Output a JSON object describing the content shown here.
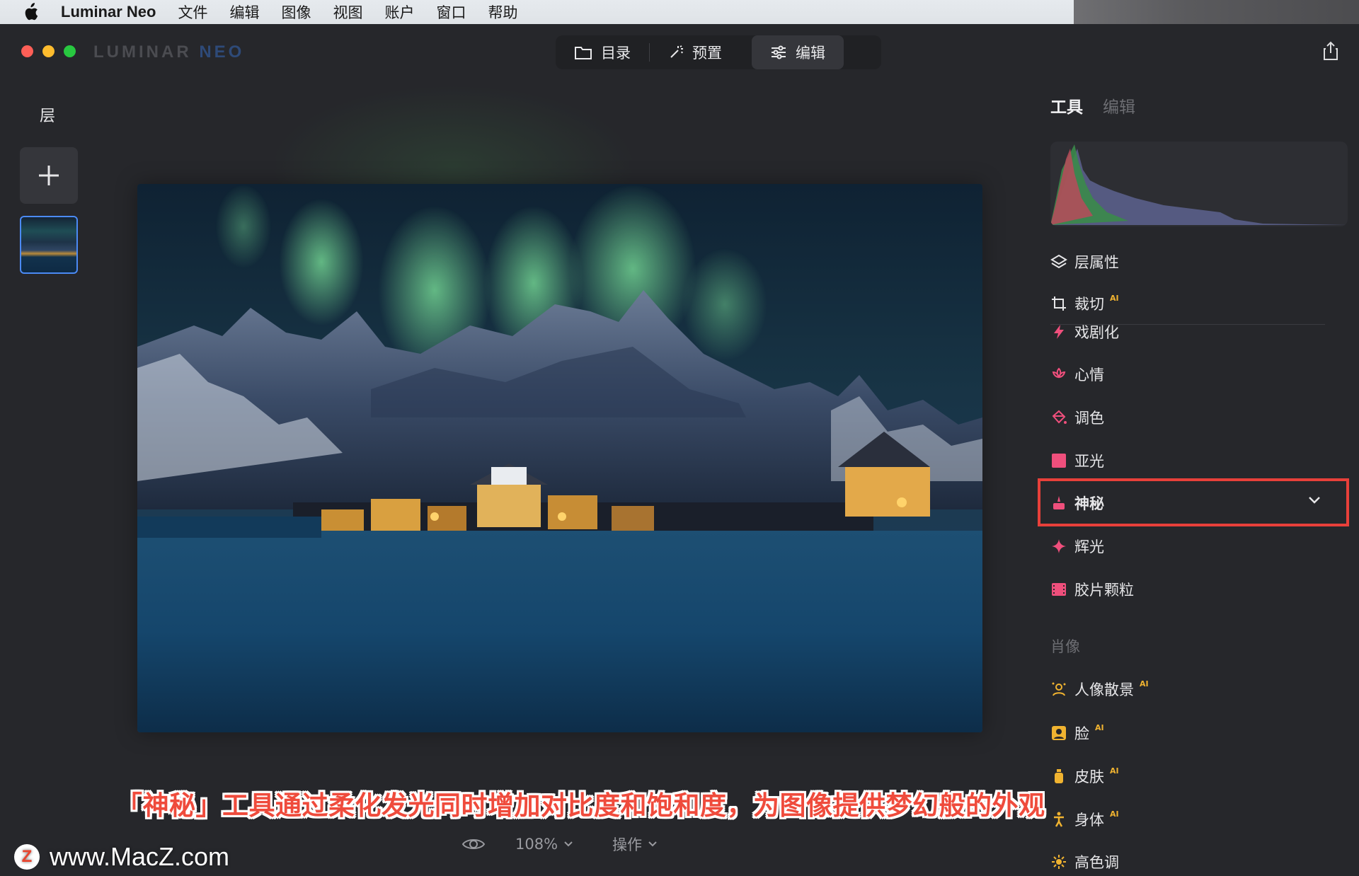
{
  "menubar": {
    "app_name": "Luminar Neo",
    "menus": [
      "文件",
      "编辑",
      "图像",
      "视图",
      "账户",
      "窗口",
      "帮助"
    ]
  },
  "window": {
    "brand": {
      "part1": "LUMINAR",
      "part2": "NEO"
    },
    "modes": [
      {
        "label": "目录",
        "icon": "folder-icon"
      },
      {
        "label": "预置",
        "icon": "magic-wand-icon"
      },
      {
        "label": "编辑",
        "icon": "sliders-icon",
        "active": true
      }
    ],
    "share_icon": "share-icon"
  },
  "layers": {
    "title": "层",
    "add_icon": "plus-icon"
  },
  "bottom": {
    "zoom": "108%",
    "actions": "操作"
  },
  "caption": "「神秘」工具通过柔化发光同时增加对比度和饱和度，为图像提供梦幻般的外观",
  "watermark": {
    "logo": "Z",
    "text": "www.MacZ.com"
  },
  "right_panel": {
    "tabs": [
      {
        "label": "工具",
        "active": true
      },
      {
        "label": "编辑",
        "active": false
      }
    ],
    "tools": [
      {
        "label": "层属性",
        "icon": "layers-icon",
        "ai": false
      },
      {
        "label": "裁切",
        "icon": "crop-icon",
        "ai": true
      },
      {
        "label": "戏剧化",
        "icon": "lightning-icon",
        "ai": false
      },
      {
        "label": "心情",
        "icon": "lotus-icon",
        "ai": false
      },
      {
        "label": "调色",
        "icon": "paint-bucket-icon",
        "ai": false
      },
      {
        "label": "亚光",
        "icon": "matte-square-icon",
        "ai": false
      },
      {
        "label": "神秘",
        "icon": "mystic-icon",
        "ai": false,
        "selected": true
      },
      {
        "label": "辉光",
        "icon": "sparkle-icon",
        "ai": false
      },
      {
        "label": "胶片颗粒",
        "icon": "film-icon",
        "ai": false
      }
    ],
    "portrait_section": "肖像",
    "portrait_tools": [
      {
        "label": "人像散景",
        "icon": "portrait-bokeh-icon",
        "ai": true
      },
      {
        "label": "脸",
        "icon": "face-icon",
        "ai": true
      },
      {
        "label": "皮肤",
        "icon": "skin-bottle-icon",
        "ai": true
      },
      {
        "label": "身体",
        "icon": "body-icon",
        "ai": true
      },
      {
        "label": "高色调",
        "icon": "high-key-icon",
        "ai": false
      }
    ],
    "ai_badge": "AI",
    "colors": {
      "accent_orange": "#f0b330",
      "accent_pink": "#ef4f7c",
      "highlight_red": "#e8403a"
    }
  }
}
